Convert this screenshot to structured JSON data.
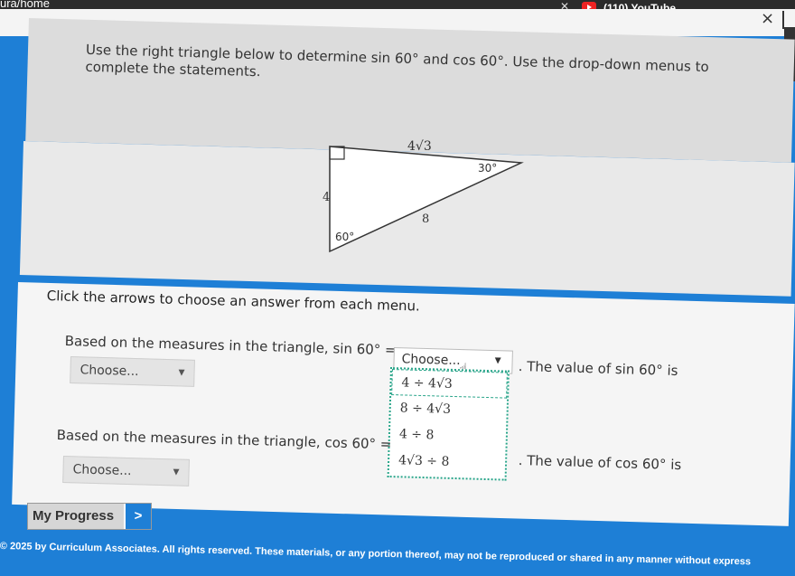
{
  "browser": {
    "url_fragment": "ura/home",
    "tab_title": "(110) YouTube"
  },
  "question": {
    "line1": "Use the right triangle below to determine sin 60° and cos 60°. Use the drop-down menus to",
    "line2": "complete the statements."
  },
  "triangle": {
    "side_top": "4√3",
    "side_left": "4",
    "hypotenuse": "8",
    "angle_top_right": "30°",
    "angle_bottom_left": "60°"
  },
  "instructions": "Click the arrows to choose an answer from each menu.",
  "statements": {
    "sin_prefix": "Based on the measures in the triangle, sin 60° =",
    "sin_suffix": ". The value of sin 60° is",
    "cos_prefix": "Based on the measures in the triangle, cos 60° =",
    "cos_suffix": ". The value of cos 60° is"
  },
  "selects": {
    "placeholder": "Choose...",
    "open_value": "Choose...",
    "options": [
      "4 ÷ 4√3",
      "8 ÷ 4√3",
      "4 ÷ 8",
      "4√3 ÷ 8"
    ]
  },
  "progress": {
    "label": "My Progress",
    "arrow": ">"
  },
  "footer": "© 2025 by Curriculum Associates. All rights reserved. These materials, or any portion thereof, may not be reproduced or shared in any manner without express"
}
